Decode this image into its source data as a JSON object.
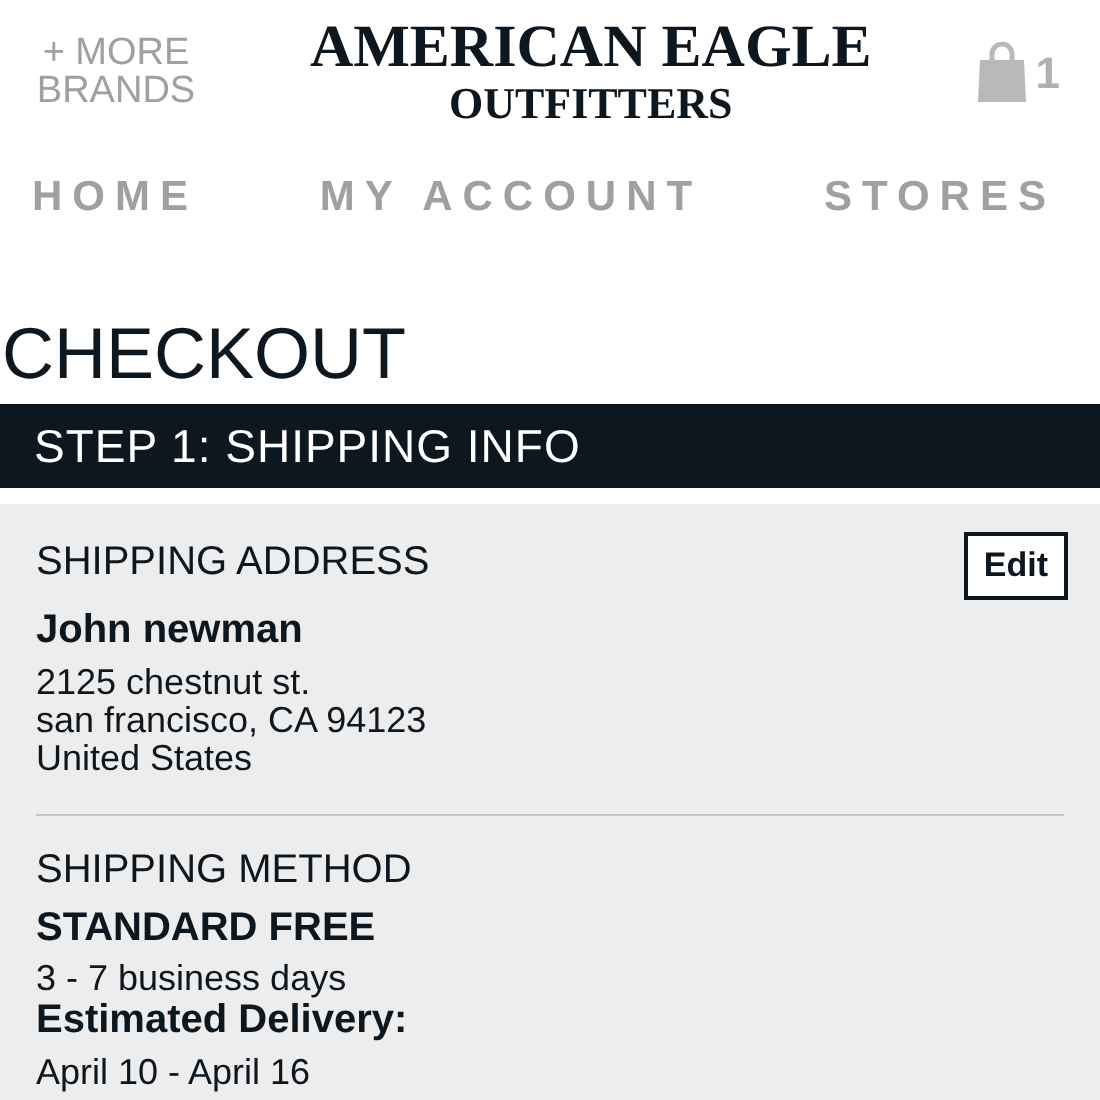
{
  "header": {
    "brands_link": [
      "+ MORE",
      "BRANDS"
    ],
    "logo": [
      "AMERICAN EAGLE",
      "OUTFITTERS"
    ],
    "cart_count": "1"
  },
  "nav": [
    "HOME",
    "MY ACCOUNT",
    "STORES"
  ],
  "page_title": "CHECKOUT",
  "step_title": "STEP 1: SHIPPING INFO",
  "shipping_address": {
    "heading": "SHIPPING ADDRESS",
    "edit_button": "Edit",
    "name": "John newman",
    "lines": [
      "2125 chestnut st.",
      "san francisco, CA 94123",
      "United States"
    ]
  },
  "shipping_method": {
    "heading": "SHIPPING METHOD",
    "method": "STANDARD FREE",
    "duration": "3 - 7 business days",
    "estimate_label": "Estimated Delivery:",
    "estimate_dates": "April 10 - April 16"
  }
}
